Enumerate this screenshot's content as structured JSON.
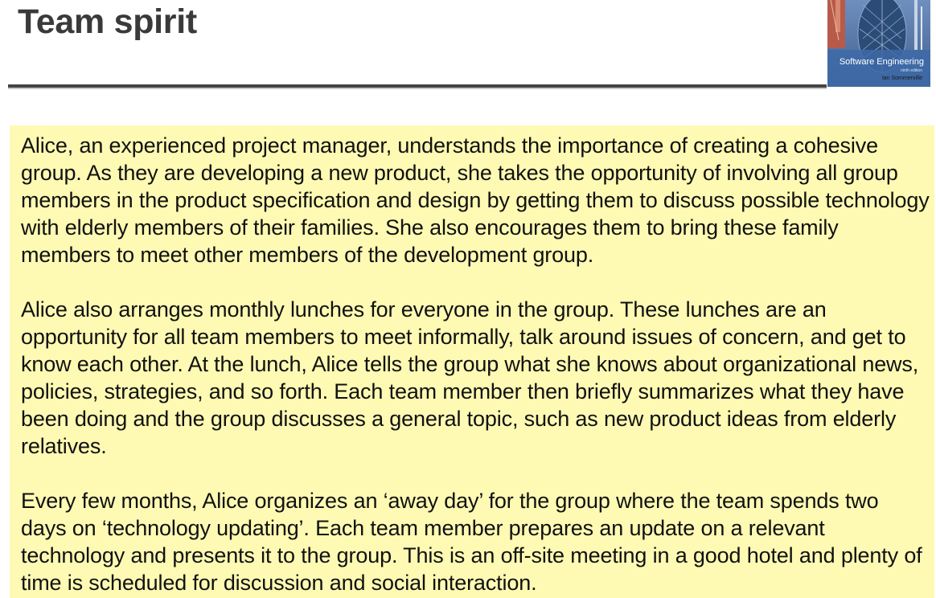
{
  "slide": {
    "title": "Team spirit"
  },
  "book_cover": {
    "title": "Software Engineering",
    "edition": "ninth edition",
    "author": "Ian Sommerville"
  },
  "content": {
    "paragraphs": [
      "Alice, an experienced project manager, understands the importance of creating a cohesive group. As they are developing a new product, she takes the opportunity of involving all group members in the product specification and design by getting them to discuss possible technology with elderly members of their families. She also encourages them to bring these family members to meet other members of the development group.",
      "Alice also arranges monthly lunches for everyone in the group. These lunches are an opportunity for all team members to meet informally, talk around issues of concern, and get to know each other. At the lunch, Alice tells the group what she knows about organizational news, policies, strategies, and so forth. Each team member then briefly summarizes what they have been doing and the group discusses a general topic, such as new product ideas from elderly relatives.",
      "Every few months, Alice organizes an ‘away day’ for the group where the team spends two days on ‘technology updating’. Each team member prepares an update on a relevant technology and presents it to the group. This is an off-site meeting in a good hotel and plenty of time is scheduled for discussion and social interaction."
    ]
  },
  "colors": {
    "content_background": "#fefab3",
    "title_text": "#3a3a3a",
    "title_rule": "#444444",
    "cover_blue": "#4a6d9c"
  }
}
